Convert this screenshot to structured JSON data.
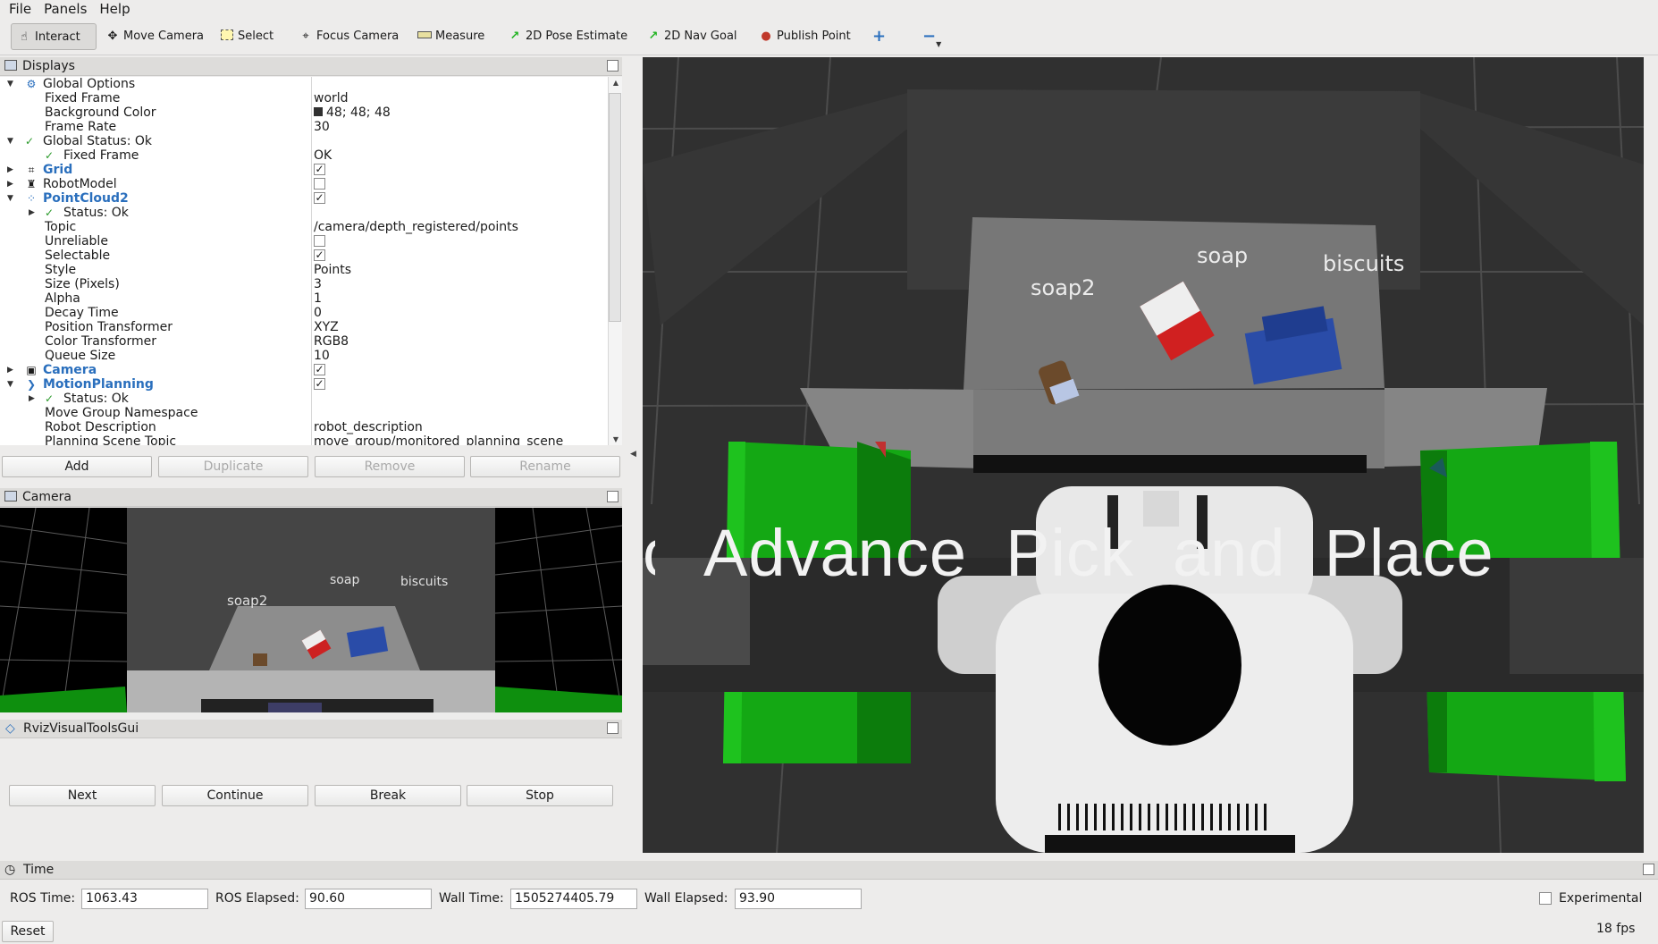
{
  "menu": [
    "File",
    "Panels",
    "Help"
  ],
  "toolbar": [
    {
      "label": "Interact",
      "icon": "hand-icon"
    },
    {
      "label": "Move Camera",
      "icon": "move-camera-icon"
    },
    {
      "label": "Select",
      "icon": "select-icon"
    },
    {
      "label": "Focus Camera",
      "icon": "focus-camera-icon"
    },
    {
      "label": "Measure",
      "icon": "ruler-icon"
    },
    {
      "label": "2D Pose Estimate",
      "icon": "green-arrow-icon"
    },
    {
      "label": "2D Nav Goal",
      "icon": "green-arrow-icon"
    },
    {
      "label": "Publish Point",
      "icon": "map-pin-icon"
    }
  ],
  "displays": {
    "title": "Displays",
    "rows": [
      {
        "label": "Global Options",
        "value": ""
      },
      {
        "label": "Fixed Frame",
        "value": "world"
      },
      {
        "label": "Background Color",
        "value": "48; 48; 48"
      },
      {
        "label": "Frame Rate",
        "value": "30"
      },
      {
        "label": "Global Status: Ok",
        "value": ""
      },
      {
        "label": "Fixed Frame",
        "value": "OK"
      },
      {
        "label": "Grid",
        "value": ""
      },
      {
        "label": "RobotModel",
        "value": ""
      },
      {
        "label": "PointCloud2",
        "value": ""
      },
      {
        "label": "Status: Ok",
        "value": ""
      },
      {
        "label": "Topic",
        "value": "/camera/depth_registered/points"
      },
      {
        "label": "Unreliable",
        "value": ""
      },
      {
        "label": "Selectable",
        "value": ""
      },
      {
        "label": "Style",
        "value": "Points"
      },
      {
        "label": "Size (Pixels)",
        "value": "3"
      },
      {
        "label": "Alpha",
        "value": "1"
      },
      {
        "label": "Decay Time",
        "value": "0"
      },
      {
        "label": "Position Transformer",
        "value": "XYZ"
      },
      {
        "label": "Color Transformer",
        "value": "RGB8"
      },
      {
        "label": "Queue Size",
        "value": "10"
      },
      {
        "label": "Camera",
        "value": ""
      },
      {
        "label": "MotionPlanning",
        "value": ""
      },
      {
        "label": "Status: Ok",
        "value": ""
      },
      {
        "label": "Move Group Namespace",
        "value": ""
      },
      {
        "label": "Robot Description",
        "value": "robot_description"
      },
      {
        "label": "Planning Scene Topic",
        "value": "move_group/monitored_planning_scene"
      }
    ],
    "buttons": [
      "Add",
      "Duplicate",
      "Remove",
      "Rename"
    ]
  },
  "camera_panel": {
    "title": "Camera",
    "labels": [
      "soap2",
      "soap",
      "biscuits"
    ]
  },
  "rviz_tools": {
    "title": "RvizVisualToolsGui",
    "buttons": [
      "Next",
      "Continue",
      "Break",
      "Stop"
    ]
  },
  "view3d": {
    "labels": [
      "soap2",
      "soap",
      "biscuits"
    ],
    "overlay_text": "Advance  Pick  and  Place",
    "background": "#303030"
  },
  "time_panel": {
    "title": "Time",
    "ros_time_label": "ROS Time:",
    "ros_time": "1063.43",
    "ros_elapsed_label": "ROS Elapsed:",
    "ros_elapsed": "90.60",
    "wall_time_label": "Wall Time:",
    "wall_time": "1505274405.79",
    "wall_elapsed_label": "Wall Elapsed:",
    "wall_elapsed": "93.90",
    "experimental_label": "Experimental",
    "reset_label": "Reset",
    "fps": "18 fps"
  }
}
